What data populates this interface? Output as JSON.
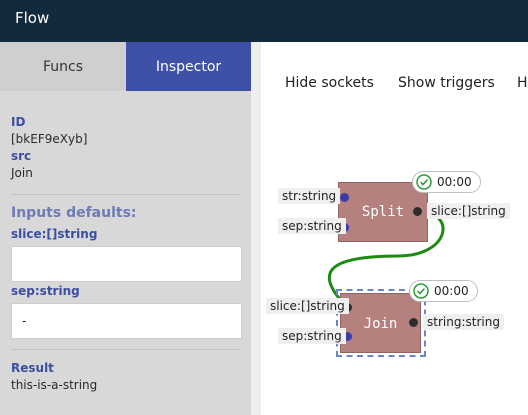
{
  "app": {
    "title": "Flow"
  },
  "tabs": [
    {
      "label": "Funcs",
      "active": false
    },
    {
      "label": "Inspector",
      "active": true
    }
  ],
  "inspector": {
    "id_label": "ID",
    "id_value": "[bkEF9eXyb]",
    "src_label": "src",
    "src_value": "Join",
    "inputs_heading": "Inputs defaults:",
    "inputs": [
      {
        "label": "slice:[]string",
        "value": ""
      },
      {
        "label": "sep:string",
        "value": "-"
      }
    ],
    "result_label": "Result",
    "result_value": "this-is-a-string"
  },
  "toolbar": {
    "hide_sockets": "Hide sockets",
    "show_triggers": "Show triggers",
    "overflow": "H"
  },
  "nodes": {
    "split": {
      "title": "Split",
      "timer": "00:00",
      "inputs": [
        "str:string",
        "sep:string"
      ],
      "output": "slice:[]string"
    },
    "join": {
      "title": "Join",
      "timer": "00:00",
      "inputs": [
        "slice:[]string",
        "sep:string"
      ],
      "output": "string:string"
    }
  },
  "colors": {
    "topbar": "#132a3c",
    "tab_active": "#3f51a6",
    "label_accent": "#3b4fa0",
    "node_fill": "#b5817f",
    "link": "#1d8a12",
    "input_socket": "#3c3ca8",
    "timer_check": "#2f9a3a",
    "selection": "#6a86c4"
  },
  "icons": {
    "timer": "check-circle-icon"
  }
}
